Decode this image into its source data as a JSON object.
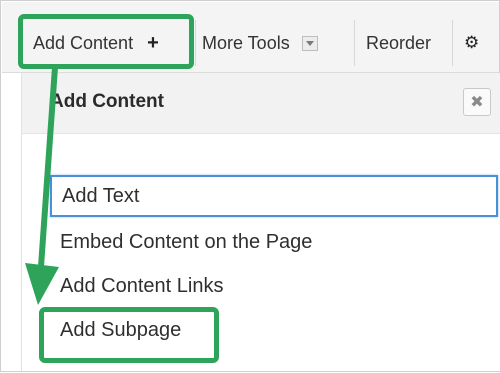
{
  "toolbar": {
    "add_content_label": "Add Content",
    "add_content_icon": "plus-icon",
    "more_tools_label": "More Tools",
    "more_tools_icon": "dropdown-icon",
    "reorder_label": "Reorder",
    "settings_icon": "gear-icon"
  },
  "panel": {
    "title": "Add Content",
    "close_icon": "close-icon",
    "items": [
      {
        "label": "Add Text"
      },
      {
        "label": "Embed Content on the Page"
      },
      {
        "label": "Add Content Links"
      },
      {
        "label": "Add Subpage"
      }
    ]
  },
  "colors": {
    "highlight": "#2ea35a",
    "focus": "#4a90d9"
  }
}
